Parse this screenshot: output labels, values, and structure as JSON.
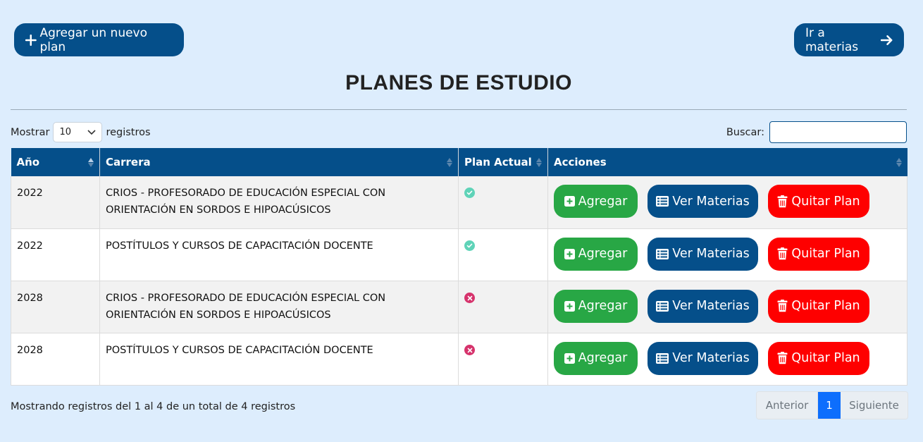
{
  "header": {
    "add_plan_label": "Agregar un nuevo plan",
    "goto_materias_label": "Ir a materias",
    "title": "PLANES DE ESTUDIO"
  },
  "controls": {
    "show_label": "Mostrar",
    "length_value": "10",
    "records_label": "registros",
    "search_label": "Buscar:",
    "search_value": ""
  },
  "table": {
    "columns": [
      "Año",
      "Carrera",
      "Plan Actual",
      "Acciones"
    ],
    "rows": [
      {
        "year": "2022",
        "career": "CRIOS - PROFESORADO DE EDUCACIÓN ESPECIAL CON ORIENTACIÓN EN SORDOS E HIPOACÚSICOS",
        "current": true
      },
      {
        "year": "2022",
        "career": "POSTÍTULOS Y CURSOS DE CAPACITACIÓN DOCENTE",
        "current": true
      },
      {
        "year": "2028",
        "career": "CRIOS - PROFESORADO DE EDUCACIÓN ESPECIAL CON ORIENTACIÓN EN SORDOS E HIPOACÚSICOS",
        "current": false
      },
      {
        "year": "2028",
        "career": "POSTÍTULOS Y CURSOS DE CAPACITACIÓN DOCENTE",
        "current": false
      }
    ],
    "action_labels": {
      "add": "Agregar",
      "view": "Ver Materias",
      "remove": "Quitar Plan"
    }
  },
  "footer": {
    "info": "Mostrando registros del 1 al 4 de un total de 4 registros",
    "prev": "Anterior",
    "page": "1",
    "next": "Siguiente"
  },
  "colors": {
    "background": "#ddedfd",
    "primary": "#054f8a",
    "success": "#28a745",
    "danger": "#fe0000",
    "status_ok": "#5fd3b8",
    "status_no": "#d6336c",
    "page_active": "#0d6efd"
  }
}
